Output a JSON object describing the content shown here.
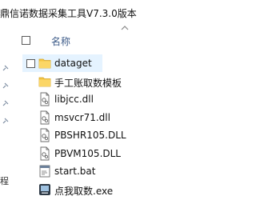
{
  "window": {
    "title": "鼎信诺数据采集工具V7.3.0版本"
  },
  "header": {
    "name_column": "名称"
  },
  "nav_stub": {
    "label": "程"
  },
  "files": [
    {
      "name": "dataget",
      "type": "folder",
      "icon": "folder-icon"
    },
    {
      "name": "手工账取数模板",
      "type": "folder",
      "icon": "folder-icon"
    },
    {
      "name": "libjcc.dll",
      "type": "dll",
      "icon": "dll-file-icon"
    },
    {
      "name": "msvcr71.dll",
      "type": "dll",
      "icon": "dll-file-icon"
    },
    {
      "name": "PBSHR105.DLL",
      "type": "dll",
      "icon": "dll-file-icon"
    },
    {
      "name": "PBVM105.DLL",
      "type": "dll",
      "icon": "dll-file-icon"
    },
    {
      "name": "start.bat",
      "type": "bat",
      "icon": "bat-file-icon"
    },
    {
      "name": "点我取数.exe",
      "type": "exe",
      "icon": "exe-file-icon"
    }
  ],
  "colors": {
    "folder": "#f5c542",
    "selection": "#e5f3ff",
    "header_text": "#3c5a88"
  }
}
